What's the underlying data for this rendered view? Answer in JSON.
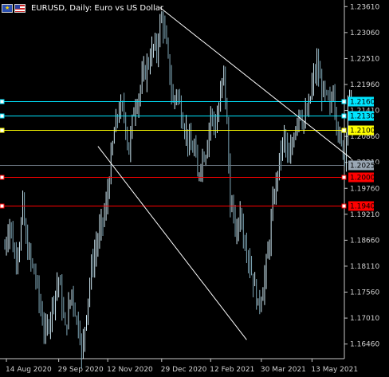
{
  "header": {
    "title": "EURUSD, Daily:  Euro vs US Dollar",
    "flags": [
      "eu-flag-icon",
      "us-flag-icon"
    ]
  },
  "chart_data": {
    "type": "bar",
    "symbol": "EURUSD",
    "timeframe": "Daily",
    "ylim": [
      1.1615,
      1.2375
    ],
    "y_ticks": [
      "1.23610",
      "1.23060",
      "1.22510",
      "1.21960",
      "1.21410",
      "1.20860",
      "1.20310",
      "1.19760",
      "1.19210",
      "1.18660",
      "1.18110",
      "1.17560",
      "1.17010",
      "1.16460"
    ],
    "y_tick_values": [
      1.2361,
      1.2306,
      1.2251,
      1.2196,
      1.2141,
      1.2086,
      1.2031,
      1.1976,
      1.1921,
      1.1866,
      1.1811,
      1.1756,
      1.1701,
      1.1646
    ],
    "x_ticks": [
      "14 Aug 2020",
      "29 Sep 2020",
      "12 Nov 2020",
      "29 Dec 2020",
      "12 Feb 2021",
      "30 Mar 2021",
      "13 May 2021"
    ],
    "x_tick_bar_index": [
      1,
      33,
      63,
      96,
      126,
      157,
      188
    ],
    "levels": [
      {
        "label": "1.21600",
        "value": 1.216,
        "color": "#00e5ff"
      },
      {
        "label": "1.21300",
        "value": 1.213,
        "color": "#00e5ff"
      },
      {
        "label": "1.21000",
        "value": 1.21,
        "color": "#ffff00"
      },
      {
        "label": "1.20000",
        "value": 1.2,
        "color": "#ff0000"
      },
      {
        "label": "1.19400",
        "value": 1.194,
        "color": "#ff0000"
      }
    ],
    "bid": {
      "label": "1.20255",
      "value": 1.20255,
      "color": "#9aa7b4"
    },
    "trendlines": [
      {
        "from": [
          95,
          1.2359
        ],
        "to": [
          212,
          1.2039
        ],
        "color": "#ffffff"
      },
      {
        "from": [
          57,
          1.2065
        ],
        "to": [
          148,
          1.1655
        ],
        "color": "#ffffff"
      }
    ],
    "anchors": [
      [
        0,
        1.185
      ],
      [
        3,
        1.1905
      ],
      [
        6,
        1.183
      ],
      [
        9,
        1.186
      ],
      [
        11,
        1.194
      ],
      [
        13,
        1.186
      ],
      [
        16,
        1.182
      ],
      [
        19,
        1.1785
      ],
      [
        22,
        1.1715
      ],
      [
        25,
        1.1665
      ],
      [
        27,
        1.1695
      ],
      [
        30,
        1.1745
      ],
      [
        33,
        1.1785
      ],
      [
        37,
        1.1675
      ],
      [
        41,
        1.176
      ],
      [
        44,
        1.1695
      ],
      [
        46,
        1.1675
      ],
      [
        47,
        1.1615
      ],
      [
        50,
        1.172
      ],
      [
        53,
        1.1805
      ],
      [
        56,
        1.1855
      ],
      [
        59,
        1.1895
      ],
      [
        62,
        1.1935
      ],
      [
        64,
        1.2005
      ],
      [
        67,
        1.2095
      ],
      [
        70,
        1.2145
      ],
      [
        73,
        1.2135
      ],
      [
        76,
        1.2055
      ],
      [
        79,
        1.2145
      ],
      [
        82,
        1.2175
      ],
      [
        85,
        1.2215
      ],
      [
        88,
        1.2245
      ],
      [
        91,
        1.2275
      ],
      [
        93,
        1.2265
      ],
      [
        94,
        1.2305
      ],
      [
        96,
        1.2335
      ],
      [
        97,
        1.2325
      ],
      [
        100,
        1.2245
      ],
      [
        103,
        1.2155
      ],
      [
        105,
        1.2185
      ],
      [
        108,
        1.2135
      ],
      [
        111,
        1.2095
      ],
      [
        114,
        1.2055
      ],
      [
        116,
        1.2065
      ],
      [
        118,
        1.1995
      ],
      [
        120,
        1.2035
      ],
      [
        123,
        1.2055
      ],
      [
        126,
        1.2135
      ],
      [
        129,
        1.2105
      ],
      [
        131,
        1.2145
      ],
      [
        134,
        1.2225
      ],
      [
        136,
        1.2105
      ],
      [
        138,
        1.1945
      ],
      [
        140,
        1.1915
      ],
      [
        142,
        1.1875
      ],
      [
        144,
        1.1935
      ],
      [
        146,
        1.1875
      ],
      [
        148,
        1.1855
      ],
      [
        150,
        1.1815
      ],
      [
        153,
        1.1765
      ],
      [
        155,
        1.1725
      ],
      [
        158,
        1.1765
      ],
      [
        161,
        1.1835
      ],
      [
        163,
        1.1905
      ],
      [
        165,
        1.1965
      ],
      [
        168,
        1.2035
      ],
      [
        171,
        1.2085
      ],
      [
        174,
        1.2025
      ],
      [
        177,
        1.2095
      ],
      [
        180,
        1.2145
      ],
      [
        183,
        1.2115
      ],
      [
        186,
        1.2145
      ],
      [
        188,
        1.2195
      ],
      [
        191,
        1.2235
      ],
      [
        194,
        1.2185
      ],
      [
        197,
        1.2165
      ],
      [
        199,
        1.2145
      ],
      [
        201,
        1.2185
      ],
      [
        203,
        1.2125
      ],
      [
        205,
        1.2075
      ],
      [
        208,
        1.2045
      ],
      [
        210,
        1.2165
      ],
      [
        212,
        1.2165
      ]
    ]
  }
}
